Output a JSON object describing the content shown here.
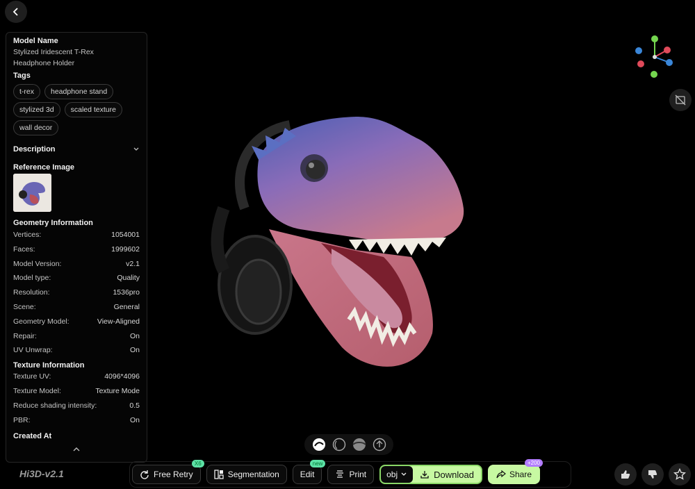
{
  "nav": {
    "back_icon": "chevron-left-icon"
  },
  "panel": {
    "model_name_label": "Model Name",
    "model_name_line1": "Stylized Iridescent T-Rex",
    "model_name_line2": "Headphone Holder",
    "tags_label": "Tags",
    "tags": [
      "t-rex",
      "headphone stand",
      "stylized 3d",
      "scaled texture",
      "wall decor"
    ],
    "description_label": "Description",
    "reference_label": "Reference Image",
    "geometry_label": "Geometry Information",
    "geometry": [
      {
        "k": "Vertices:",
        "v": "1054001"
      },
      {
        "k": "Faces:",
        "v": "1999602"
      },
      {
        "k": "Model Version:",
        "v": "v2.1"
      },
      {
        "k": "Model type:",
        "v": "Quality"
      },
      {
        "k": "Resolution:",
        "v": "1536pro"
      },
      {
        "k": "Scene:",
        "v": "General"
      },
      {
        "k": "Geometry Model:",
        "v": "View-Aligned"
      },
      {
        "k": "Repair:",
        "v": "On"
      },
      {
        "k": "UV Unwrap:",
        "v": "On"
      }
    ],
    "texture_label": "Texture Information",
    "texture": [
      {
        "k": "Texture UV:",
        "v": "4096*4096"
      },
      {
        "k": "Texture Model:",
        "v": "Texture Mode"
      },
      {
        "k": "Reduce shading intensity:",
        "v": "0.5"
      },
      {
        "k": "PBR:",
        "v": "On"
      }
    ],
    "created_label": "Created At"
  },
  "brand": "Hi3D-v2.1",
  "toolbar": {
    "free_retry": "Free Retry",
    "free_retry_badge": "X6",
    "segmentation": "Segmentation",
    "edit": "Edit",
    "edit_badge": "new",
    "print": "Print",
    "format": "obj",
    "download": "Download",
    "share": "Share",
    "share_badge": "+200"
  },
  "colors": {
    "accent": "#c7f9a2",
    "panel_border": "#262626"
  }
}
